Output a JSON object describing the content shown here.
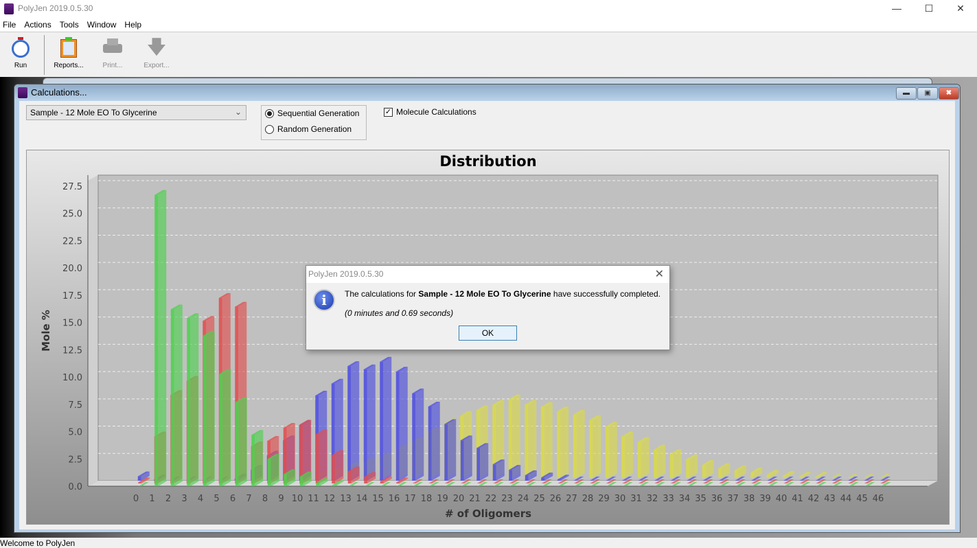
{
  "app": {
    "title": "PolyJen 2019.0.5.30"
  },
  "menu": [
    "File",
    "Actions",
    "Tools",
    "Window",
    "Help"
  ],
  "toolbar": {
    "run": "Run",
    "reports": "Reports...",
    "print": "Print...",
    "export": "Export..."
  },
  "frame": {
    "title": "Calculations...",
    "sample": "Sample - 12 Mole EO To Glycerine",
    "sequential": "Sequential Generation",
    "random": "Random Generation",
    "generation_selected": "Sequential Generation",
    "molecule_calc": "Molecule Calculations",
    "molecule_calc_checked": true
  },
  "dialog": {
    "title": "PolyJen 2019.0.5.30",
    "msg_pre": "The calculations for ",
    "msg_bold": "Sample - 12 Mole EO To Glycerine",
    "msg_post": " have successfully completed.",
    "time": "(0 minutes and 0.69 seconds)",
    "ok": "OK",
    "icon": "info-icon"
  },
  "status": "Welcome to PolyJen",
  "chart_data": {
    "type": "bar",
    "style": "3d",
    "title": "Distribution",
    "xlabel": "# of Oligomers",
    "ylabel": "Mole %",
    "ylim": [
      0,
      27.5
    ],
    "yticks": [
      "0.0",
      "2.5",
      "5.0",
      "7.5",
      "10.0",
      "12.5",
      "15.0",
      "17.5",
      "20.0",
      "22.5",
      "25.0",
      "27.5"
    ],
    "grid": true,
    "categories": [
      0,
      1,
      2,
      3,
      4,
      5,
      6,
      7,
      8,
      9,
      10,
      11,
      12,
      13,
      14,
      15,
      16,
      17,
      18,
      19,
      20,
      21,
      22,
      23,
      24,
      25,
      26,
      27,
      28,
      29,
      30,
      31,
      32,
      33,
      34,
      35,
      36,
      37,
      38,
      39,
      40,
      41,
      42,
      43,
      44,
      45,
      46
    ],
    "series": [
      {
        "color": "#d9d94a",
        "values": [
          0,
          0,
          0,
          0,
          0,
          0,
          0,
          0,
          0,
          0,
          0,
          0.2,
          0.5,
          1.0,
          1.4,
          1.9,
          2.6,
          3.3,
          4.2,
          5.0,
          5.7,
          6.2,
          6.7,
          7.2,
          6.7,
          6.5,
          6.1,
          5.8,
          5.3,
          4.7,
          3.8,
          3.3,
          2.6,
          2.2,
          1.7,
          1.2,
          0.9,
          0.7,
          0.5,
          0.3,
          0.2,
          0.1,
          0.1,
          0,
          0,
          0,
          0
        ]
      },
      {
        "color": "#5050e0",
        "values": [
          0.4,
          0.1,
          0,
          0,
          0,
          0,
          0.2,
          1.0,
          2.3,
          3.7,
          5.1,
          7.8,
          8.9,
          10.5,
          10.2,
          10.9,
          10.0,
          8.0,
          6.8,
          5.2,
          3.7,
          3.0,
          1.5,
          1.0,
          0.5,
          0.3,
          0.1,
          0,
          0,
          0,
          0,
          0,
          0,
          0,
          0,
          0,
          0,
          0,
          0,
          0,
          0,
          0,
          0,
          0,
          0,
          0,
          0
        ]
      },
      {
        "color": "#e05050",
        "values": [
          0.1,
          4.3,
          8.1,
          9.4,
          14.9,
          17.0,
          16.2,
          3.4,
          3.9,
          5.1,
          5.4,
          4.5,
          2.6,
          1.1,
          0.6,
          0.2,
          0.1,
          0,
          0,
          0,
          0,
          0,
          0,
          0,
          0,
          0,
          0,
          0,
          0,
          0,
          0,
          0,
          0,
          0,
          0,
          0,
          0,
          0,
          0,
          0,
          0,
          0,
          0,
          0,
          0,
          0,
          0
        ]
      },
      {
        "color": "#50d050",
        "values": [
          0,
          26.7,
          16.2,
          15.4,
          13.8,
          10.3,
          7.7,
          4.7,
          2.5,
          1.1,
          0.9,
          0.3,
          0.1,
          0,
          0,
          0,
          0,
          0,
          0,
          0,
          0,
          0,
          0,
          0,
          0,
          0,
          0,
          0,
          0,
          0,
          0,
          0,
          0,
          0,
          0,
          0,
          0,
          0,
          0,
          0,
          0,
          0,
          0,
          0,
          0,
          0,
          0
        ]
      }
    ]
  }
}
